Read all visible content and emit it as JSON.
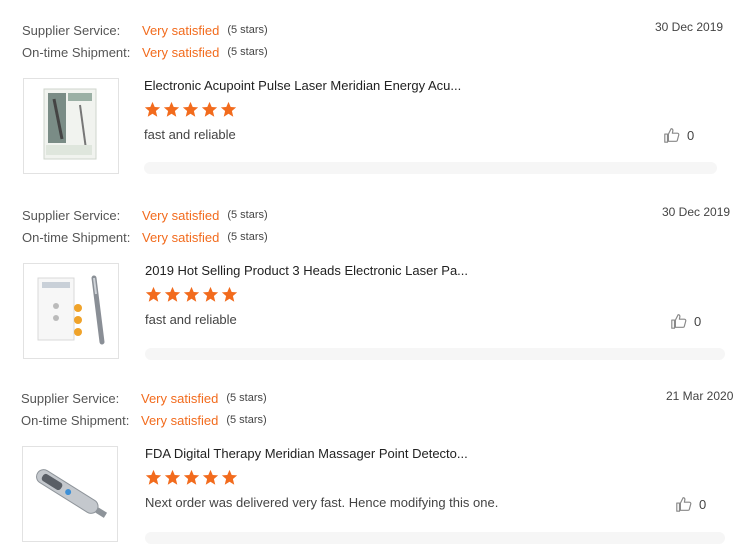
{
  "reviews": [
    {
      "supplier_label": "Supplier Service:",
      "supplier_value": "Very satisfied",
      "supplier_stars": "(5 stars)",
      "shipment_label": "On-time Shipment:",
      "shipment_value": "Very satisfied",
      "shipment_stars": "(5 stars)",
      "date": "30 Dec 2019",
      "product_title": "Electronic Acupoint Pulse Laser Meridian Energy Acu...",
      "rating": 5,
      "comment": "fast and reliable",
      "likes": "0"
    },
    {
      "supplier_label": "Supplier Service:",
      "supplier_value": "Very satisfied",
      "supplier_stars": "(5 stars)",
      "shipment_label": "On-time Shipment:",
      "shipment_value": "Very satisfied",
      "shipment_stars": "(5 stars)",
      "date": "30 Dec 2019",
      "product_title": "2019 Hot Selling Product 3 Heads Electronic Laser Pa...",
      "rating": 5,
      "comment": "fast and reliable",
      "likes": "0"
    },
    {
      "supplier_label": "Supplier Service:",
      "supplier_value": "Very satisfied",
      "supplier_stars": "(5 stars)",
      "shipment_label": "On-time Shipment:",
      "shipment_value": "Very satisfied",
      "shipment_stars": "(5 stars)",
      "date": "21 Mar 2020",
      "product_title": "FDA Digital Therapy Meridian Massager Point Detecto...",
      "rating": 5,
      "comment": "Next order was delivered very fast. Hence modifying this one.",
      "likes": "0"
    }
  ],
  "colors": {
    "accent": "#f26b1d",
    "star": "#f26b1d",
    "text": "#333333"
  },
  "icons": {
    "star": "star-icon",
    "like": "thumbs-up-icon"
  }
}
